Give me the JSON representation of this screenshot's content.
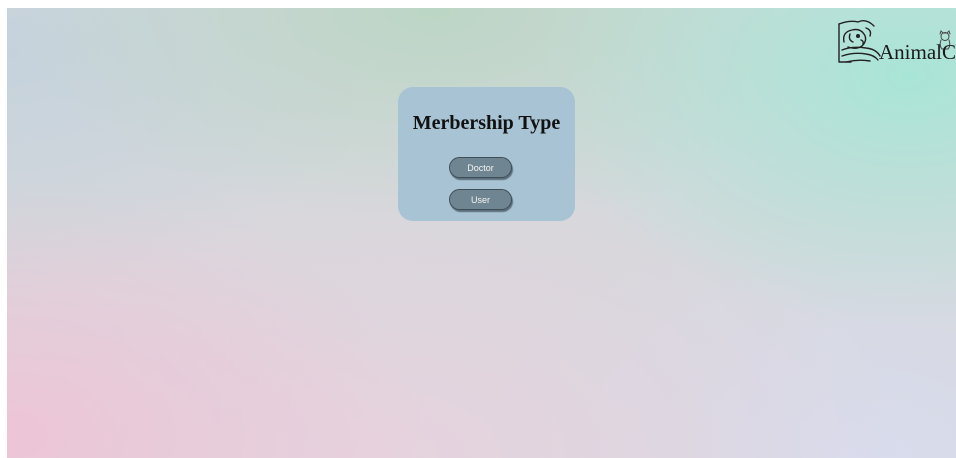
{
  "header": {
    "logo_text": "AnimalCare",
    "logo_icon": "hand-holding-dog-icon",
    "logo_secondary_icon": "cat-icon"
  },
  "membership": {
    "title": "Merbership Type",
    "options": [
      {
        "label": "Doctor"
      },
      {
        "label": "User"
      }
    ]
  },
  "colors": {
    "card_background": "#a8c3d4",
    "button_background": "#6f8692",
    "button_border": "#3f4f59",
    "button_text": "#f2f4f5"
  }
}
